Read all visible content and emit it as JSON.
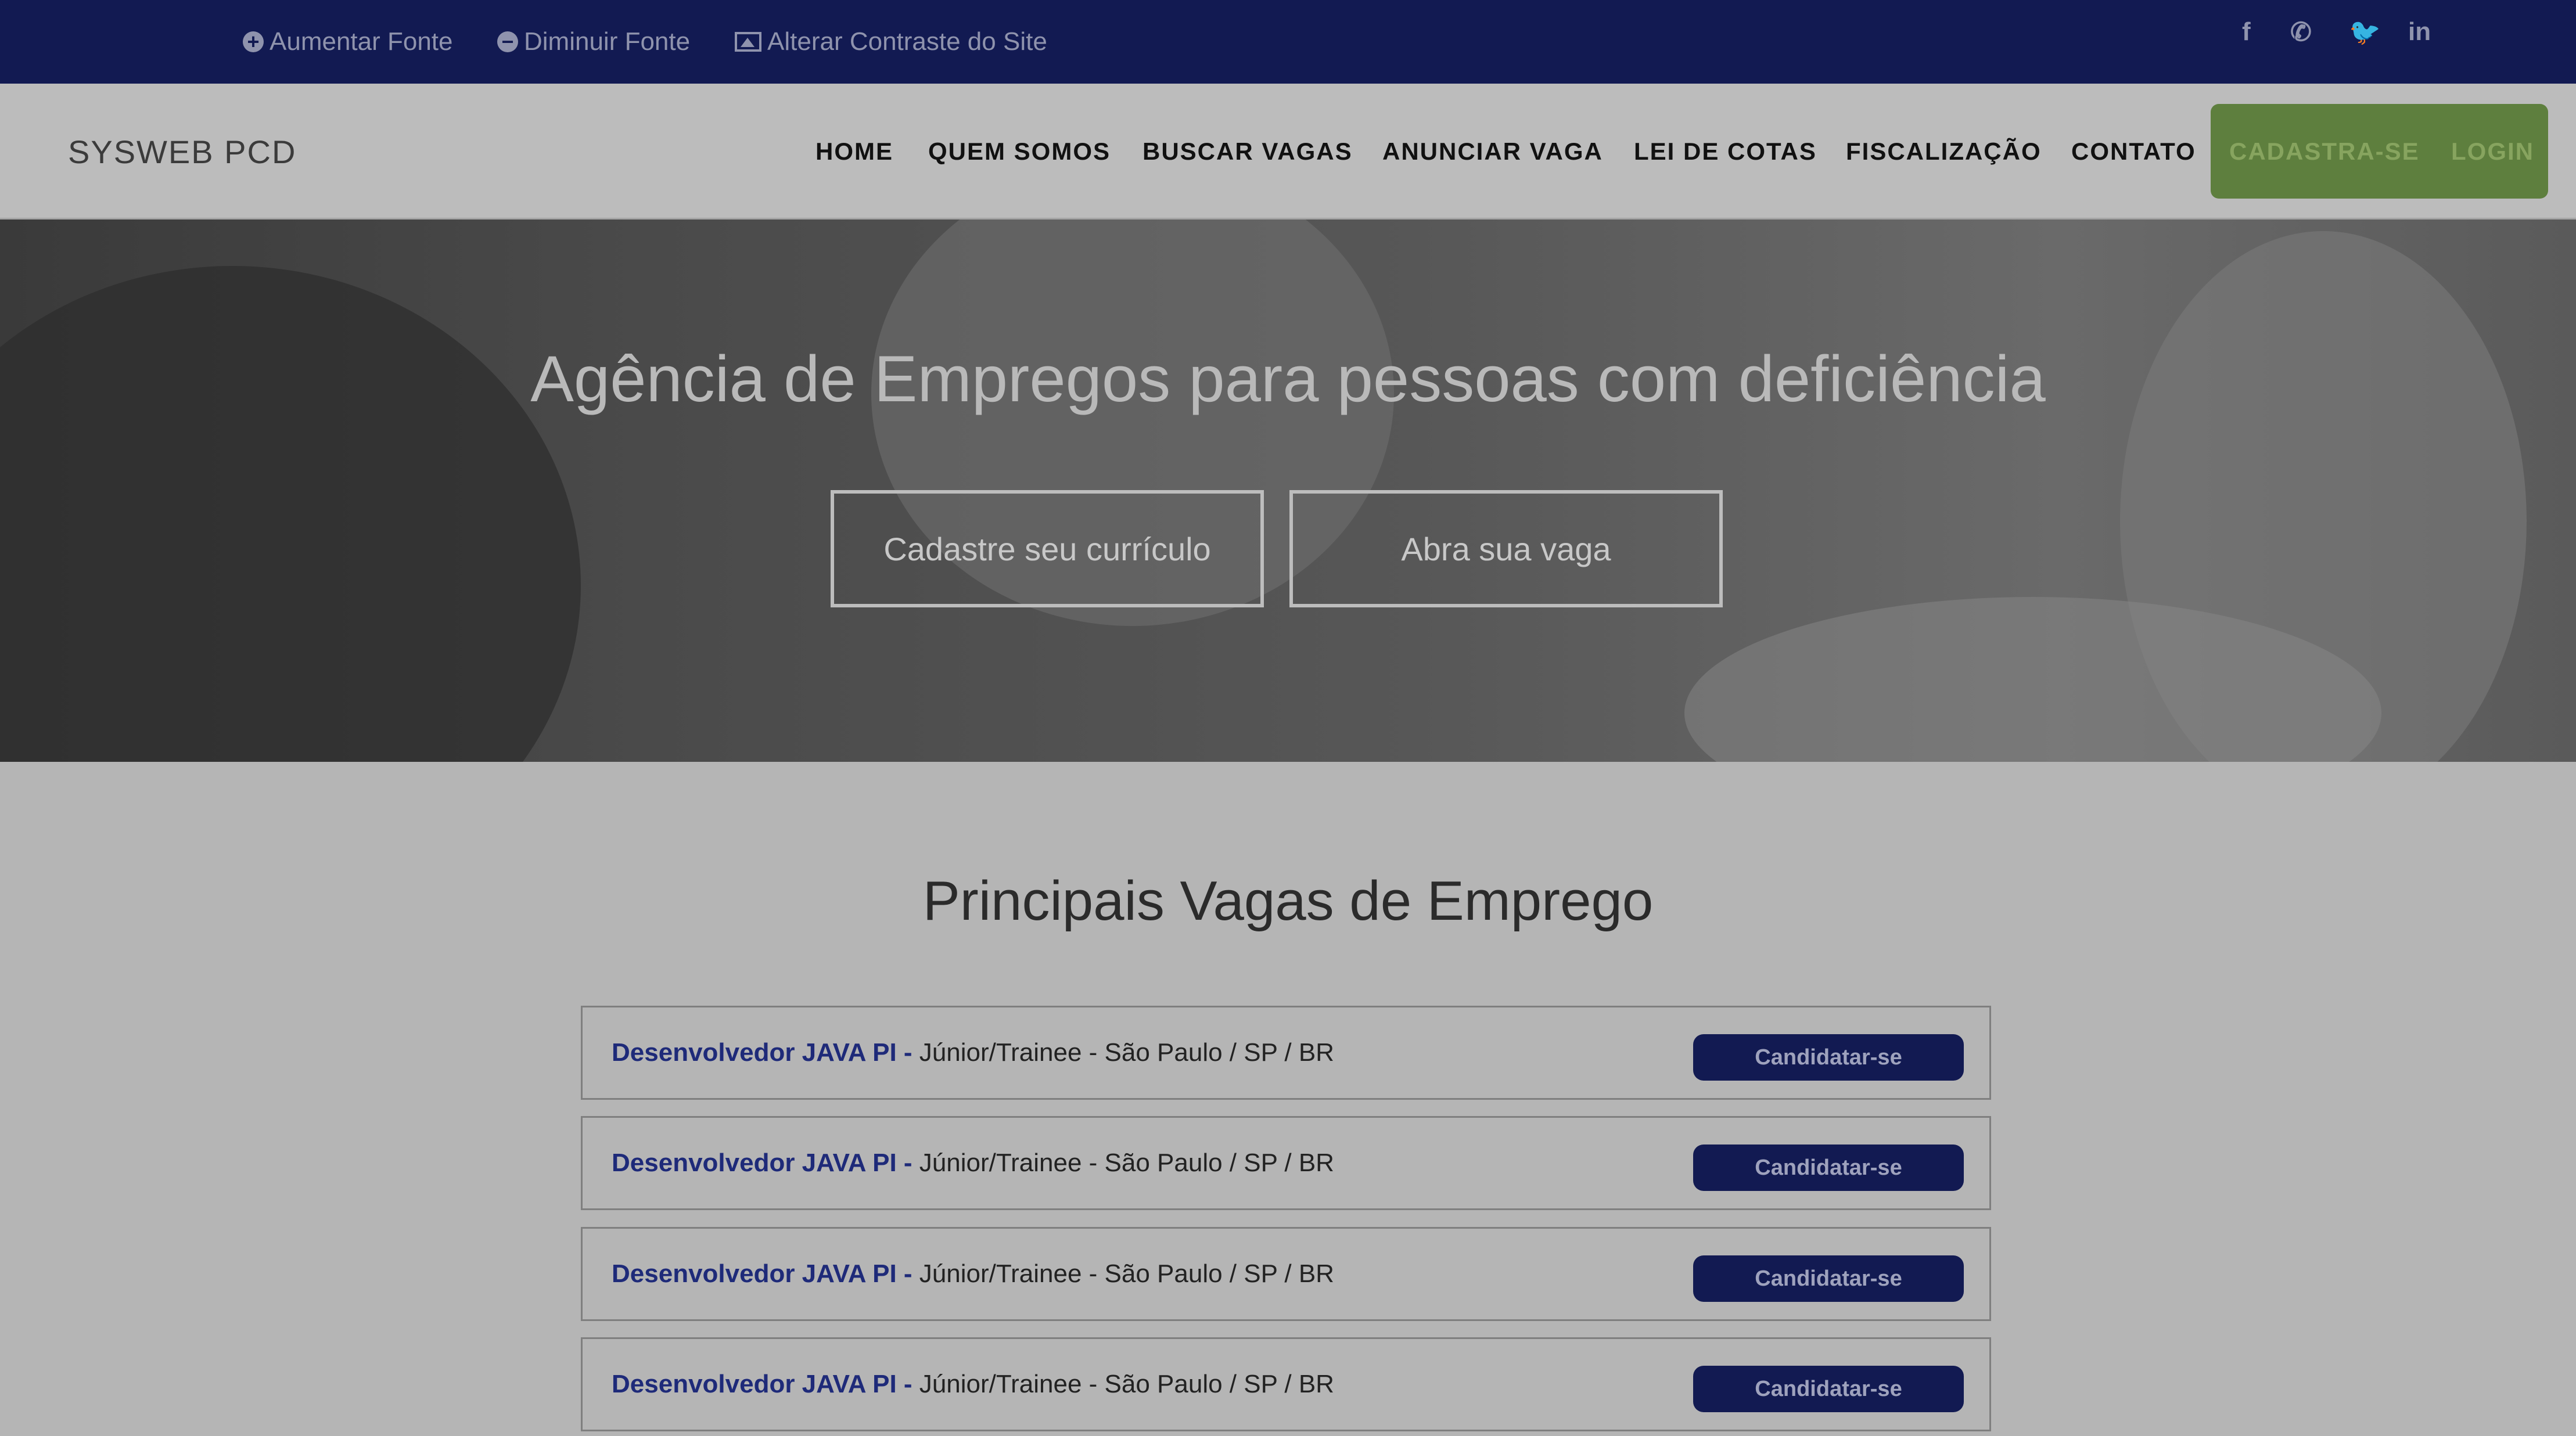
{
  "accessibility": {
    "increase_font": "Aumentar Fonte",
    "decrease_font": "Diminuir Fonte",
    "contrast": "Alterar Contraste do Site"
  },
  "social": {
    "facebook": "f",
    "whatsapp": "✆",
    "twitter": "🐦",
    "linkedin": "in",
    "icons": [
      "facebook-icon",
      "whatsapp-icon",
      "twitter-icon",
      "linkedin-icon"
    ]
  },
  "nav": {
    "brand": "SYSWEB PCD",
    "items": [
      "HOME",
      "QUEM SOMOS",
      "BUSCAR VAGAS",
      "ANUNCIAR VAGA",
      "LEI DE COTAS",
      "FISCALIZAÇÃO",
      "CONTATO"
    ],
    "signup": "CADASTRA-SE",
    "login": "LOGIN"
  },
  "hero": {
    "title": "Agência de Empregos para pessoas com deficiência",
    "btn_resume": "Cadastre seu currículo",
    "btn_job": "Abra sua vaga"
  },
  "jobs_section": {
    "title": "Principais Vagas de Emprego",
    "apply_label": "Candidatar-se",
    "jobs": [
      {
        "role": "Desenvolvedor JAVA PI - ",
        "meta": "Júnior/Trainee - São Paulo / SP / BR"
      },
      {
        "role": "Desenvolvedor JAVA PI - ",
        "meta": "Júnior/Trainee - São Paulo / SP / BR"
      },
      {
        "role": "Desenvolvedor JAVA PI - ",
        "meta": "Júnior/Trainee - São Paulo / SP / BR"
      },
      {
        "role": "Desenvolvedor JAVA PI - ",
        "meta": "Júnior/Trainee - São Paulo / SP / BR"
      }
    ]
  },
  "colors": {
    "topbar": "#121a52",
    "accent_green": "#5e7f3e",
    "job_title": "#1e2a79"
  }
}
